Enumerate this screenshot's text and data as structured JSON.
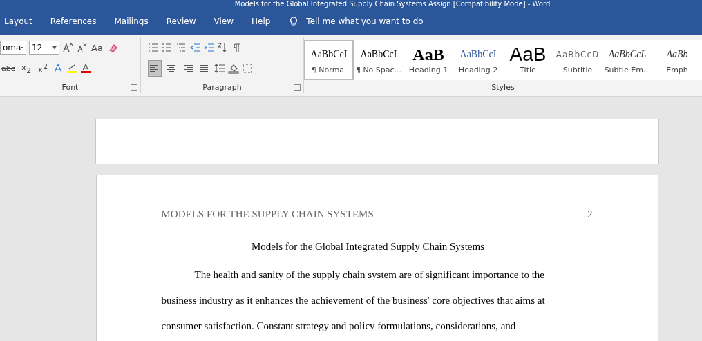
{
  "window": {
    "title": "Models for the Global Integrated Supply Chain Systems Assign [Compatibility Mode]  -  Word"
  },
  "tabs": [
    {
      "label": "Layout",
      "selected": false
    },
    {
      "label": "References",
      "selected": false
    },
    {
      "label": "Mailings",
      "selected": false
    },
    {
      "label": "Review",
      "selected": false
    },
    {
      "label": "View",
      "selected": false
    },
    {
      "label": "Help",
      "selected": false
    }
  ],
  "tell_me": {
    "placeholder": "Tell me what you want to do"
  },
  "font_group": {
    "font_name": "oma",
    "font_size": "12",
    "change_case": "Aa",
    "strikethrough": "abc",
    "subscript": "x$_{2}$",
    "superscript": "x$^{2}$",
    "label": "Font"
  },
  "paragraph_group": {
    "label": "Paragraph",
    "alignments": [
      {
        "kind": "left",
        "selected": true
      },
      {
        "kind": "center",
        "selected": false
      },
      {
        "kind": "right",
        "selected": false
      },
      {
        "kind": "justify",
        "selected": false
      }
    ]
  },
  "styles_group": {
    "label": "Styles",
    "styles": [
      {
        "kind": "normal",
        "preview": "AaBbCcI",
        "name": "¶ Normal",
        "selected": true
      },
      {
        "kind": "normal",
        "preview": "AaBbCcI",
        "name": "¶ No Spac...",
        "selected": false
      },
      {
        "kind": "heading1",
        "preview": "AaB",
        "name": "Heading 1",
        "selected": false
      },
      {
        "kind": "heading2",
        "preview": "AaBbCcI",
        "name": "Heading 2",
        "selected": false
      },
      {
        "kind": "title",
        "preview": "AaB",
        "name": "Title",
        "selected": false
      },
      {
        "kind": "subtitle",
        "preview": "AaBbCcD",
        "name": "Subtitle",
        "selected": false
      },
      {
        "kind": "emphasis",
        "preview": "AaBbCcL",
        "name": "Subtle Em...",
        "selected": false
      },
      {
        "kind": "emphasis",
        "preview": "AaBb",
        "name": "Emph",
        "selected": false
      }
    ]
  },
  "document": {
    "running_head": "MODELS FOR THE SUPPLY CHAIN SYSTEMS",
    "page_number": "2",
    "title": "Models for the Global Integrated Supply Chain Systems",
    "paragraph": "The health and sanity of the supply chain system are of significant importance to the business industry as it enhances the achievement of the business' core objectives that aims at consumer satisfaction. Constant strategy and policy formulations, considerations, and"
  }
}
